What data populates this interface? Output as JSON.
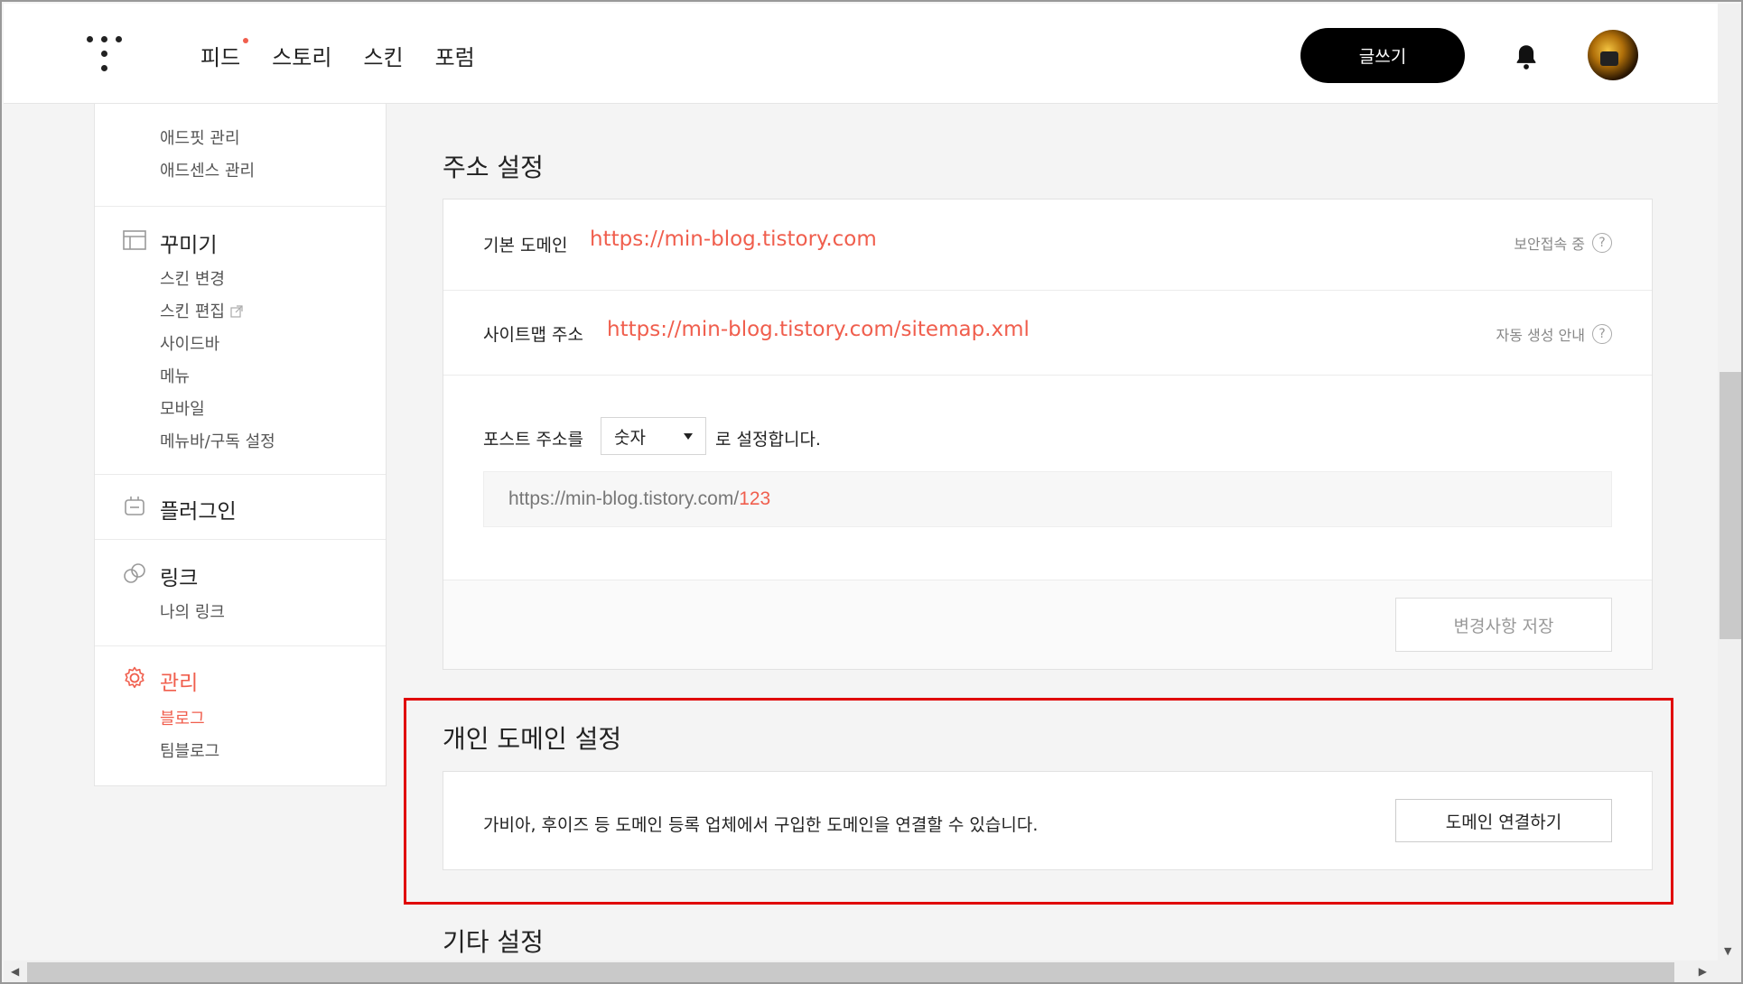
{
  "header": {
    "nav": [
      "피드",
      "스토리",
      "스킨",
      "포럼"
    ],
    "write_label": "글쓰기"
  },
  "sidebar": {
    "top_items": [
      "애드핏 관리",
      "애드센스 관리"
    ],
    "decorate": {
      "heading": "꾸미기",
      "items": [
        "스킨 변경",
        "스킨 편집",
        "사이드바",
        "메뉴",
        "모바일",
        "메뉴바/구독 설정"
      ]
    },
    "plugin": {
      "heading": "플러그인"
    },
    "link": {
      "heading": "링크",
      "items": [
        "나의 링크"
      ]
    },
    "manage": {
      "heading": "관리",
      "items": [
        "블로그",
        "팀블로그"
      ]
    }
  },
  "address": {
    "title": "주소 설정",
    "base_label": "기본 도메인",
    "base_url": "https://min-blog.tistory.com",
    "base_help": "보안접속 중",
    "sitemap_label": "사이트맵 주소",
    "sitemap_url": "https://min-blog.tistory.com/sitemap.xml",
    "sitemap_help": "자동 생성 안내",
    "post_prefix": "포스트 주소를",
    "post_select": "숫자",
    "post_suffix": "로 설정합니다.",
    "preview_base": "https://min-blog.tistory.com/",
    "preview_num": "123",
    "save_label": "변경사항 저장"
  },
  "custom_domain": {
    "title": "개인 도메인 설정",
    "description": "가비아, 후이즈 등 도메인 등록 업체에서 구입한 도메인을 연결할 수 있습니다.",
    "button": "도메인 연결하기"
  },
  "other": {
    "title": "기타 설정"
  },
  "help_mark": "?",
  "colors": {
    "accent": "#f05e4d",
    "highlight": "#e00000"
  }
}
